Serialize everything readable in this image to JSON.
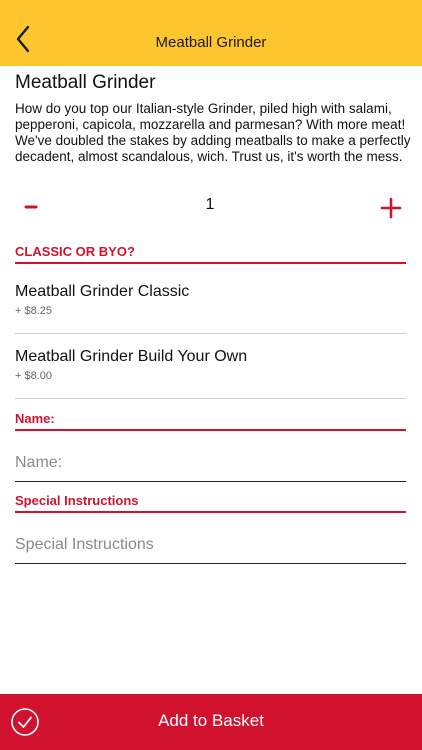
{
  "header": {
    "title": "Meatball Grinder",
    "back_icon": "chevron-left-icon"
  },
  "item": {
    "title": "Meatball Grinder",
    "description": "How do you top our Italian-style Grinder, piled high with salami, pepperoni, capicola, mozzarella and parmesan? With more meat! We've doubled the stakes by adding meatballs to make a perfectly decadent, almost scandalous, wich. Trust us, it's worth the mess."
  },
  "quantity": {
    "minus_label": "-",
    "plus_label": "+",
    "value": "1"
  },
  "sections": {
    "classic_or_byo": {
      "heading": "CLASSIC OR BYO?",
      "options": [
        {
          "name": "Meatball Grinder Classic",
          "price": "+ $8.25"
        },
        {
          "name": "Meatball Grinder Build Your Own",
          "price": "+ $8.00"
        }
      ]
    },
    "name": {
      "heading": "Name:",
      "placeholder": "Name:"
    },
    "special_instructions": {
      "heading": "Special Instructions",
      "placeholder": "Special Instructions"
    }
  },
  "footer": {
    "label": "Add to Basket",
    "icon": "check-circle-icon"
  },
  "colors": {
    "header_bg": "#FDC62F",
    "accent_red": "#D0122F",
    "text": "#111111",
    "muted": "#666666"
  }
}
